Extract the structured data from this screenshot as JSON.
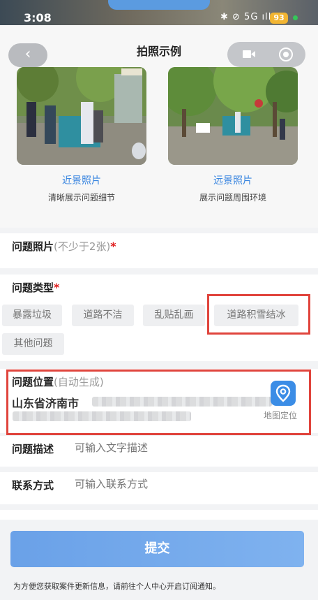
{
  "status_bar": {
    "time": "3:08",
    "icons_text": "✱ ⊘ 5G ıll",
    "battery": "93"
  },
  "header": {
    "title": "拍照示例",
    "back_icon": "chevron-left-icon",
    "capsule_icons": [
      "video-icon",
      "record-icon"
    ]
  },
  "examples": [
    {
      "label": "近景照片",
      "desc": "清晰展示问题细节"
    },
    {
      "label": "远景照片",
      "desc": "展示问题周围环境"
    }
  ],
  "form": {
    "photos": {
      "label": "问题照片",
      "hint": "(不少于2张)",
      "required": "*"
    },
    "type": {
      "label": "问题类型",
      "required": "*",
      "options": [
        "暴露垃圾",
        "道路不洁",
        "乱贴乱画",
        "道路积雪结冰",
        "其他问题"
      ],
      "highlighted": "道路积雪结冰"
    },
    "location": {
      "label": "问题位置",
      "hint": "(自动生成)",
      "address": "山东省济南市",
      "map_button": "地图定位"
    },
    "description": {
      "label": "问题描述",
      "placeholder": "可输入文字描述"
    },
    "contact": {
      "label": "联系方式",
      "placeholder": "可输入联系方式"
    }
  },
  "submit_label": "提交",
  "notice": "为方便您获取案件更新信息，请前往个人中心开启订阅通知。",
  "colors": {
    "accent": "#3a86e0",
    "highlight": "#e0443c",
    "required": "#e02020",
    "submit": "#6aa1e8"
  }
}
